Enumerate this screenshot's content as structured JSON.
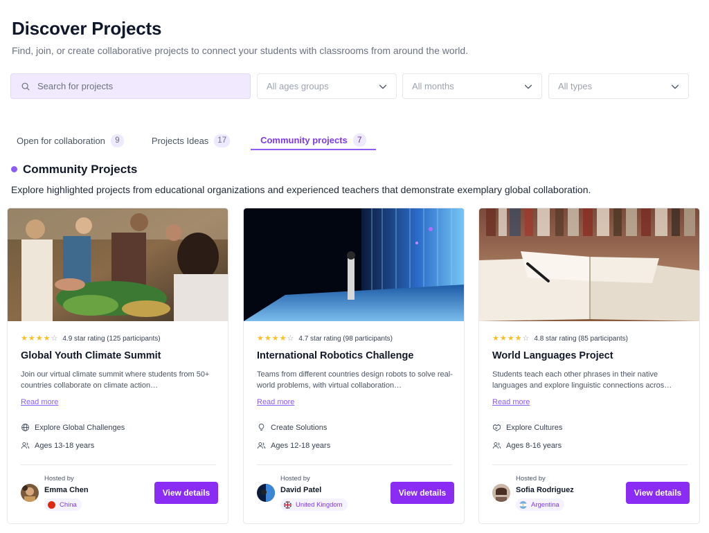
{
  "page": {
    "title": "Discover Projects",
    "subtitle": "Find, join, or create collaborative projects to connect your students with classrooms from around the world."
  },
  "filters": {
    "search_placeholder": "Search for projects",
    "age_group": "All ages groups",
    "months": "All months",
    "types": "All types"
  },
  "tabs": [
    {
      "label": "Open for collaboration",
      "count": "9",
      "active": false
    },
    {
      "label": "Projects Ideas",
      "count": "17",
      "active": false
    },
    {
      "label": "Community projects",
      "count": "7",
      "active": true
    }
  ],
  "section": {
    "title": "Community Projects",
    "description": "Explore highlighted projects from educational organizations and experienced teachers that demonstrate exemplary global collaboration."
  },
  "colors": {
    "accent": "#8b2cf5",
    "accent_light": "#f1e9fd",
    "star": "#fbbf24"
  },
  "cards": [
    {
      "rating": "4.9 star rating (125 participants)",
      "stars_filled": 4,
      "title": "Global Youth Climate Summit",
      "description": "Join our virtual climate summit where students from 50+ countries collaborate on climate action…",
      "read_more": "Read more",
      "meta1_icon": "globe-icon",
      "meta1": "Explore Global Challenges",
      "meta2_icon": "users-icon",
      "meta2": "Ages 13-18 years",
      "hosted_by_label": "Hosted by",
      "host_name": "Emma Chen",
      "country": "China",
      "country_flag": "china-flag-icon",
      "button": "View details"
    },
    {
      "rating": "4.7 star rating (98 participants)",
      "stars_filled": 4,
      "title": "International Robotics Challenge",
      "description": "Teams from different countries design robots to solve real-world problems, with virtual collaboration…",
      "read_more": "Read more",
      "meta1_icon": "lightbulb-icon",
      "meta1": "Create Solutions",
      "meta2_icon": "users-icon",
      "meta2": "Ages 12-18 years",
      "hosted_by_label": "Hosted by",
      "host_name": "David Patel",
      "country": "United Kingdom",
      "country_flag": "uk-flag-icon",
      "button": "View details"
    },
    {
      "rating": "4.8 star rating (85 participants)",
      "stars_filled": 4,
      "title": "World Languages Project",
      "description": "Students teach each other phrases in their native languages and explore linguistic connections acros…",
      "read_more": "Read more",
      "meta1_icon": "handshake-icon",
      "meta1": "Explore Cultures",
      "meta2_icon": "users-icon",
      "meta2": "Ages 8-16 years",
      "hosted_by_label": "Hosted by",
      "host_name": "Sofia Rodriguez",
      "country": "Argentina",
      "country_flag": "argentina-flag-icon",
      "button": "View details"
    }
  ]
}
